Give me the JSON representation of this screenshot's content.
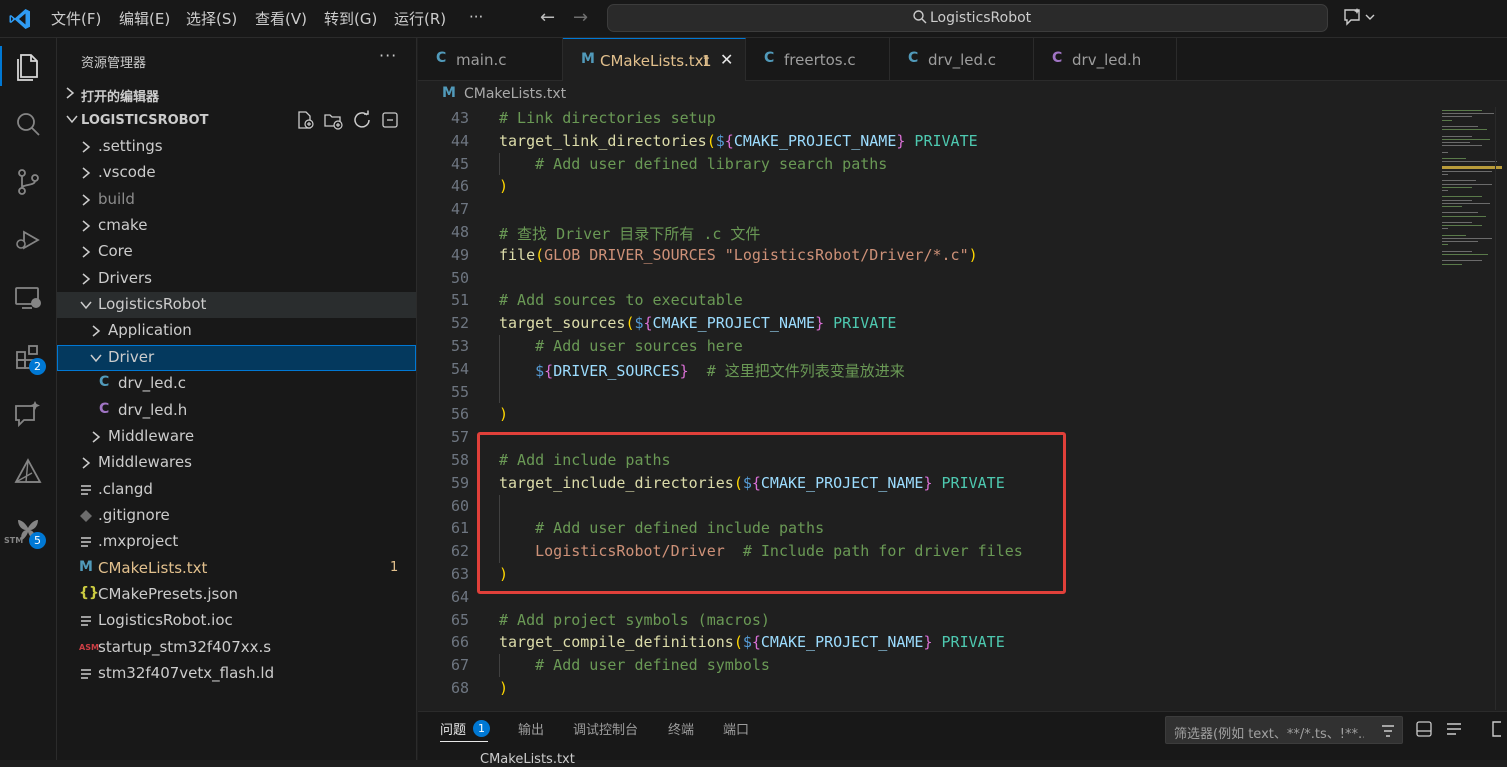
{
  "titlebar": {
    "menus": [
      "文件(F)",
      "编辑(E)",
      "选择(S)",
      "查看(V)",
      "转到(G)",
      "运行(R)",
      "···"
    ],
    "search_text": "LogisticsRobot"
  },
  "activitybar": {
    "extensions_badge": "2",
    "stm32_badge": "5",
    "stm32_label": "STM"
  },
  "sidebar": {
    "title": "资源管理器",
    "open_editors": "打开的编辑器",
    "project": "LOGISTICSROBOT",
    "tree": [
      {
        "label": ".settings",
        "type": "folder"
      },
      {
        "label": ".vscode",
        "type": "folder"
      },
      {
        "label": "build",
        "type": "folder"
      },
      {
        "label": "cmake",
        "type": "folder"
      },
      {
        "label": "Core",
        "type": "folder"
      },
      {
        "label": "Drivers",
        "type": "folder"
      },
      {
        "label": "LogisticsRobot",
        "type": "folder-open"
      },
      {
        "label": "Application",
        "type": "folder"
      },
      {
        "label": "Driver",
        "type": "folder-open"
      },
      {
        "label": "drv_led.c",
        "type": "c"
      },
      {
        "label": "drv_led.h",
        "type": "h"
      },
      {
        "label": "Middleware",
        "type": "folder"
      },
      {
        "label": "Middlewares",
        "type": "folder"
      },
      {
        "label": ".clangd",
        "type": "lines"
      },
      {
        "label": ".gitignore",
        "type": "git"
      },
      {
        "label": ".mxproject",
        "type": "lines"
      },
      {
        "label": "CMakeLists.txt",
        "type": "cmake"
      },
      {
        "label": "CMakePresets.json",
        "type": "json"
      },
      {
        "label": "LogisticsRobot.ioc",
        "type": "lines"
      },
      {
        "label": "startup_stm32f407xx.s",
        "type": "asm"
      },
      {
        "label": "stm32f407vetx_flash.ld",
        "type": "lines"
      }
    ],
    "cmake_problem_count": "1",
    "icon_glyphs": {
      "c": "C",
      "h": "C",
      "cmake": "M",
      "json": "{}",
      "asm": "ASM"
    }
  },
  "tabs": [
    {
      "icon": "C",
      "label": "main.c"
    },
    {
      "icon": "M",
      "label": "CMakeLists.txt",
      "badge": "1",
      "close": "✕"
    },
    {
      "icon": "C",
      "label": "freertos.c"
    },
    {
      "icon": "C",
      "label": "drv_led.c"
    },
    {
      "icon": "C",
      "label": "drv_led.h"
    }
  ],
  "breadcrumb": {
    "icon": "M",
    "label": "CMakeLists.txt"
  },
  "code": {
    "line_numbers": [
      "43",
      "44",
      "45",
      "46",
      "47",
      "48",
      "49",
      "50",
      "51",
      "52",
      "53",
      "54",
      "55",
      "56",
      "57",
      "58",
      "59",
      "60",
      "61",
      "62",
      "63",
      "64",
      "65",
      "66",
      "67",
      "68"
    ],
    "lines": [
      [
        {
          "t": "# Link directories setup",
          "c": "com"
        }
      ],
      [
        {
          "t": "target_link_directories",
          "c": "fn"
        },
        {
          "t": "(",
          "c": "brk"
        },
        {
          "t": "$",
          "c": "dol"
        },
        {
          "t": "{",
          "c": "brk2"
        },
        {
          "t": "CMAKE_PROJECT_NAME",
          "c": "var"
        },
        {
          "t": "}",
          "c": "brk2"
        },
        {
          "t": " PRIVATE",
          "c": "kw"
        }
      ],
      [
        {
          "t": "    # Add user defined library search paths",
          "c": "com"
        }
      ],
      [
        {
          "t": ")",
          "c": "brk"
        }
      ],
      [],
      [
        {
          "t": "# 查找 Driver 目录下所有 .c 文件",
          "c": "com"
        }
      ],
      [
        {
          "t": "file",
          "c": "fn"
        },
        {
          "t": "(",
          "c": "brk"
        },
        {
          "t": "GLOB DRIVER_SOURCES ",
          "c": "str"
        },
        {
          "t": "\"LogisticsRobot/Driver/*.c\"",
          "c": "str"
        },
        {
          "t": ")",
          "c": "brk"
        }
      ],
      [],
      [
        {
          "t": "# Add sources to executable",
          "c": "com"
        }
      ],
      [
        {
          "t": "target_sources",
          "c": "fn"
        },
        {
          "t": "(",
          "c": "brk"
        },
        {
          "t": "$",
          "c": "dol"
        },
        {
          "t": "{",
          "c": "brk2"
        },
        {
          "t": "CMAKE_PROJECT_NAME",
          "c": "var"
        },
        {
          "t": "}",
          "c": "brk2"
        },
        {
          "t": " PRIVATE",
          "c": "kw"
        }
      ],
      [
        {
          "t": "    # Add user sources here",
          "c": "com"
        }
      ],
      [
        {
          "t": "    ",
          "c": "def"
        },
        {
          "t": "$",
          "c": "dol"
        },
        {
          "t": "{",
          "c": "brk2"
        },
        {
          "t": "DRIVER_SOURCES",
          "c": "var"
        },
        {
          "t": "}",
          "c": "brk2"
        },
        {
          "t": "  # 这里把文件列表变量放进来",
          "c": "com"
        }
      ],
      [],
      [
        {
          "t": ")",
          "c": "brk"
        }
      ],
      [],
      [
        {
          "t": "# Add include paths",
          "c": "com"
        }
      ],
      [
        {
          "t": "target_include_directories",
          "c": "fn"
        },
        {
          "t": "(",
          "c": "brk"
        },
        {
          "t": "$",
          "c": "dol"
        },
        {
          "t": "{",
          "c": "brk2"
        },
        {
          "t": "CMAKE_PROJECT_NAME",
          "c": "var"
        },
        {
          "t": "}",
          "c": "brk2"
        },
        {
          "t": " PRIVATE",
          "c": "kw"
        }
      ],
      [],
      [
        {
          "t": "    # Add user defined include paths",
          "c": "com"
        }
      ],
      [
        {
          "t": "    LogisticsRobot/Driver",
          "c": "str"
        },
        {
          "t": "  # Include path for driver files",
          "c": "com"
        }
      ],
      [
        {
          "t": ")",
          "c": "brk"
        }
      ],
      [],
      [
        {
          "t": "# Add project symbols (macros)",
          "c": "com"
        }
      ],
      [
        {
          "t": "target_compile_definitions",
          "c": "fn"
        },
        {
          "t": "(",
          "c": "brk"
        },
        {
          "t": "$",
          "c": "dol"
        },
        {
          "t": "{",
          "c": "brk2"
        },
        {
          "t": "CMAKE_PROJECT_NAME",
          "c": "var"
        },
        {
          "t": "}",
          "c": "brk2"
        },
        {
          "t": " PRIVATE",
          "c": "kw"
        }
      ],
      [
        {
          "t": "    # Add user defined symbols",
          "c": "com"
        }
      ],
      [
        {
          "t": ")",
          "c": "brk"
        }
      ]
    ]
  },
  "panel": {
    "tabs": [
      "问题",
      "输出",
      "调试控制台",
      "终端",
      "端口"
    ],
    "problems_badge": "1",
    "filter_placeholder": "筛选器(例如 text、**/*.ts、!**...",
    "subrow": "CMakeLists.txt"
  }
}
